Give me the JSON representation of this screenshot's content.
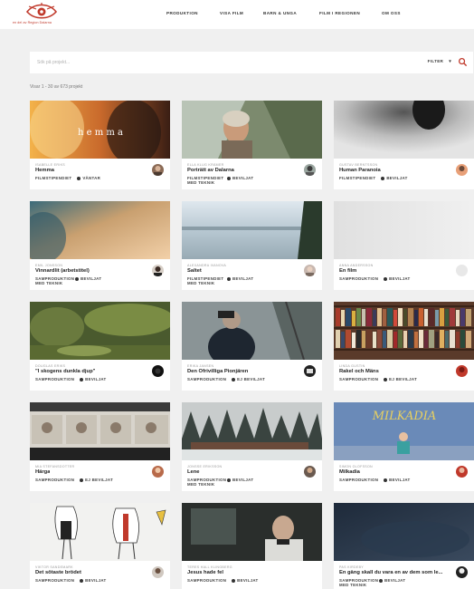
{
  "header": {
    "logo_text": "en del av Region Dalarna",
    "nav": [
      "PRODUKTION",
      "VISA FILM",
      "BARN & UNGA",
      "FILM I REGIONEN",
      "OM OSS"
    ]
  },
  "search": {
    "placeholder": "Sök på projekt...",
    "filter_label": "FILTER"
  },
  "results_label": "Visar 1 - 30 av 673 projekt",
  "cards": [
    {
      "director": "Isabelle Eriks",
      "title": "Hemma",
      "category": "FILMSTIPENDIET",
      "status": "VÄNTAR",
      "status_color": "#333333"
    },
    {
      "director": "Ella Klug Krämer",
      "title": "Porträtt av Dalarna",
      "category": "FILMSTIPENDIET MED TEKNIK",
      "status": "BEVILJAT",
      "status_color": "#333333"
    },
    {
      "director": "Gustav Berntsson",
      "title": "Human Paranoia",
      "category": "FILMSTIPENDIET",
      "status": "BEVILJAT",
      "status_color": "#333333"
    },
    {
      "director": "Emil Jonsson",
      "title": "Vinnardlit (arbetstitel)",
      "category": "SAMPRODUKTION MED TEKNIK",
      "status": "BEVILJAT",
      "status_color": "#333333"
    },
    {
      "director": "Alexandra Ivanova",
      "title": "Saltet",
      "category": "FILMSTIPENDIET MED TEKNIK",
      "status": "BEVILJAT",
      "status_color": "#333333"
    },
    {
      "director": "Anna Andersson",
      "title": "En film",
      "category": "SAMPRODUKTION",
      "status": "BEVILJAT",
      "status_color": "#333333"
    },
    {
      "director": "Douglas Eriks",
      "title": "\"I skogens dunkla djup\"",
      "category": "SAMPRODUKTION",
      "status": "BEVILJAT",
      "status_color": "#333333"
    },
    {
      "director": "Erika Jansen",
      "title": "Den Ofrivilliga Pionjären",
      "category": "SAMPRODUKTION",
      "status": "EJ BEVILJAT",
      "status_color": "#333333"
    },
    {
      "director": "Linda Gustin",
      "title": "Rakel och Mäns",
      "category": "SAMPRODUKTION",
      "status": "EJ BEVILJAT",
      "status_color": "#333333"
    },
    {
      "director": "Mia Stefansdotter",
      "title": "Härga",
      "category": "SAMPRODUKTION",
      "status": "EJ BEVILJAT",
      "status_color": "#333333"
    },
    {
      "director": "Jonsse Eriksson",
      "title": "Lene",
      "category": "SAMPRODUKTION MED TEKNIK",
      "status": "BEVILJAT",
      "status_color": "#333333"
    },
    {
      "director": "Simon Olofsson",
      "title": "Milkadia",
      "category": "SAMPRODUKTION",
      "status": "BEVILJAT",
      "status_color": "#333333"
    },
    {
      "director": "Viktor Sandemark",
      "title": "Det sötaste brödet",
      "category": "SAMPRODUKTION",
      "status": "BEVILJAT",
      "status_color": "#333333"
    },
    {
      "director": "Teres Hall Klingberg",
      "title": "Jesus hade fel",
      "category": "SAMPRODUKTION",
      "status": "BEVILJAT",
      "status_color": "#333333"
    },
    {
      "director": "Pas Kirdeby",
      "title": "En gång skall du vara en av dem som le...",
      "category": "SAMPRODUKTION MED TEKNIK",
      "status": "BEVILJAT",
      "status_color": "#333333"
    }
  ],
  "thumb_texts": {
    "hemma": "h e m m a",
    "milkadia": "MILKADIA"
  },
  "colors": {
    "brand": "#c0392b",
    "search_accent": "#c0392b"
  }
}
